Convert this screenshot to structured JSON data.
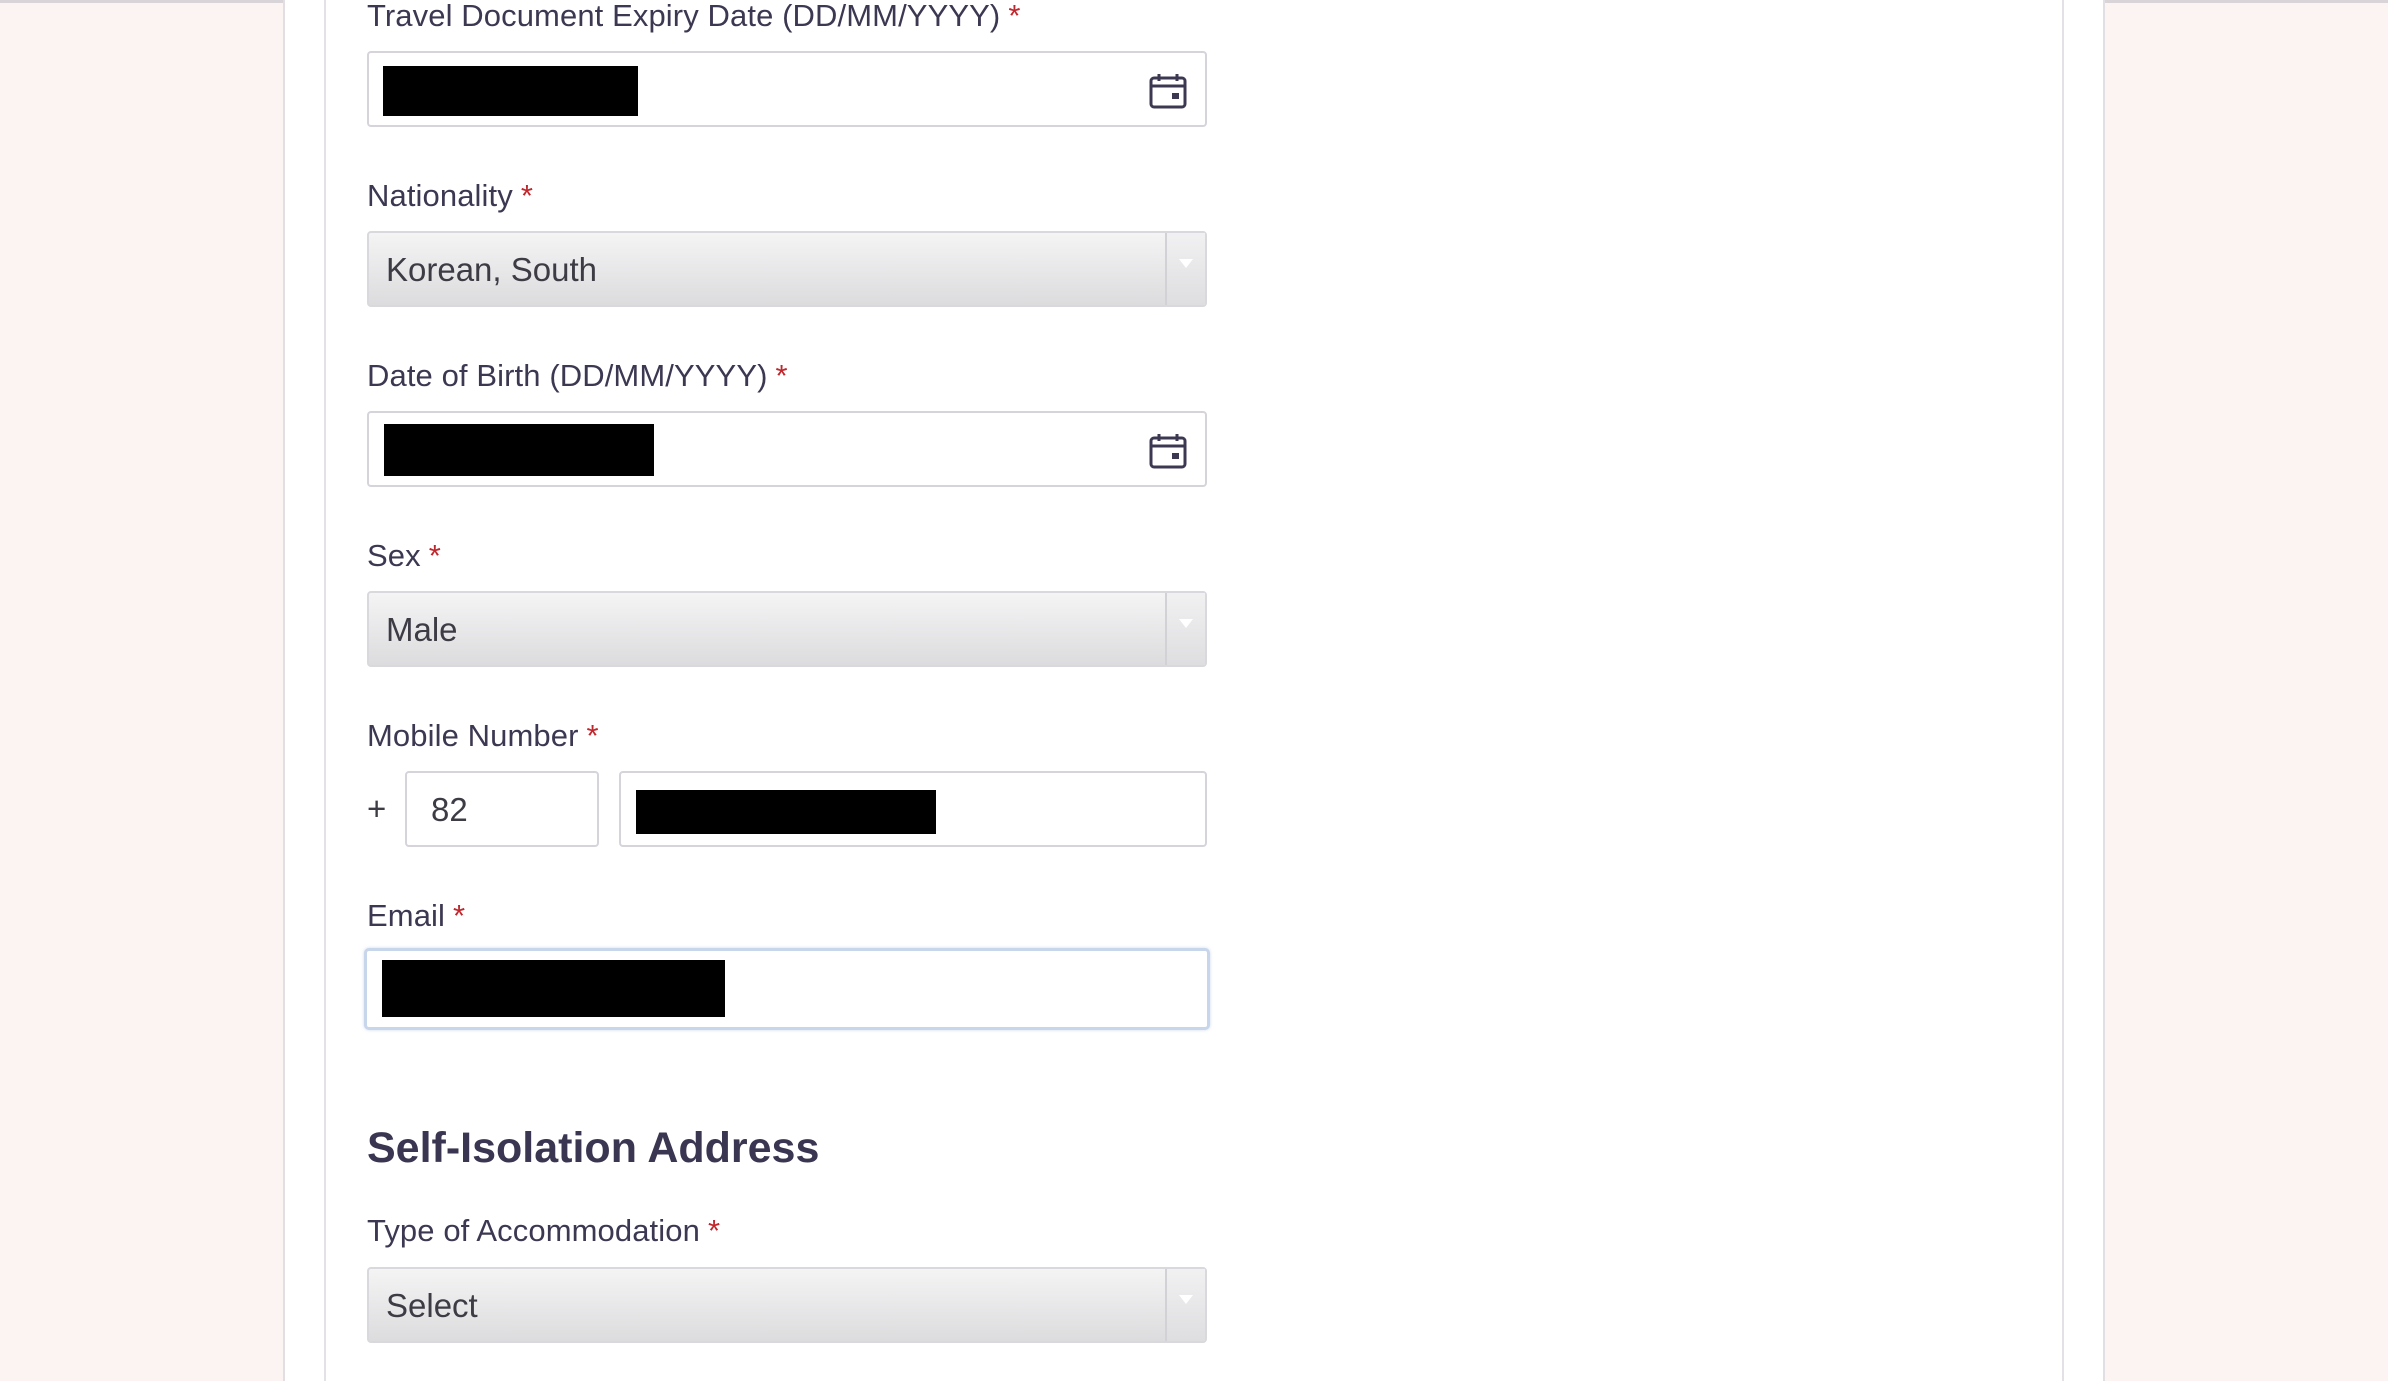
{
  "form": {
    "travel_doc_expiry": {
      "label": "Travel Document Expiry Date (DD/MM/YYYY)",
      "required_marker": "*",
      "icon": "calendar-icon"
    },
    "nationality": {
      "label": "Nationality",
      "required_marker": "*",
      "selected": "Korean, South"
    },
    "date_of_birth": {
      "label": "Date of Birth (DD/MM/YYYY)",
      "required_marker": "*",
      "icon": "calendar-icon"
    },
    "sex": {
      "label": "Sex",
      "required_marker": "*",
      "selected": "Male"
    },
    "mobile_number": {
      "label": "Mobile Number",
      "required_marker": "*",
      "plus_sign": "+",
      "country_code": "82"
    },
    "email": {
      "label": "Email",
      "required_marker": "*"
    },
    "self_isolation": {
      "heading": "Self-Isolation Address",
      "accommodation_type": {
        "label": "Type of Accommodation",
        "required_marker": "*",
        "selected": "Select"
      }
    }
  },
  "colors": {
    "required": "#c0272d",
    "text": "#3d3852",
    "focus_border": "#c7d6ea",
    "side_background": "#fcf3f3"
  }
}
